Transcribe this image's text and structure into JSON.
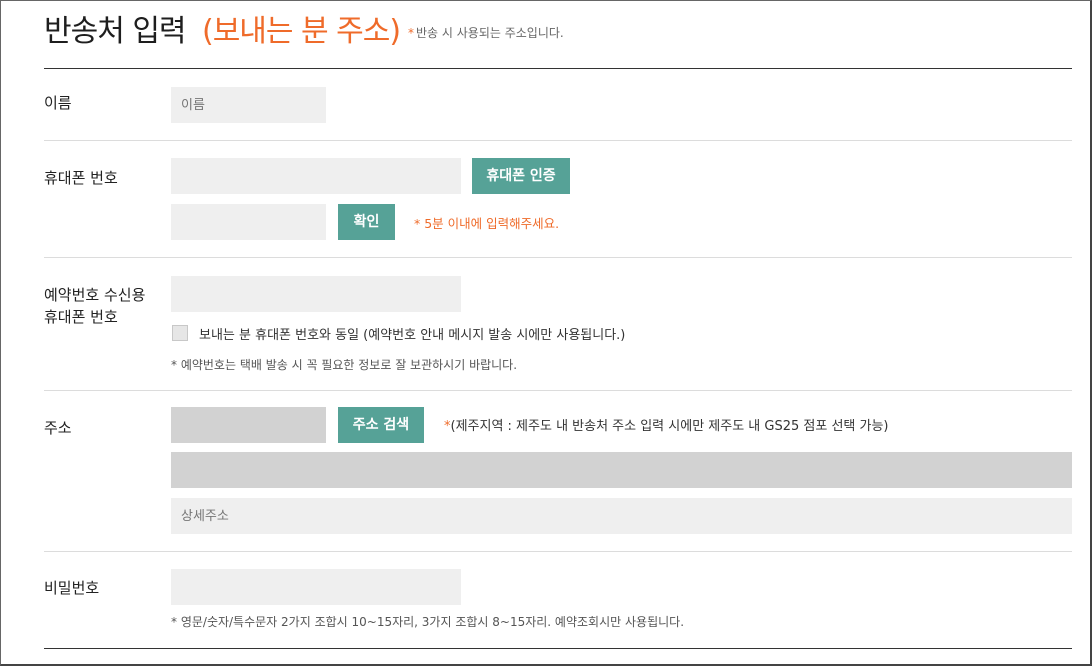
{
  "header": {
    "title": "반송처 입력",
    "subtitle": "(보내는 분 주소)",
    "note_star": "*",
    "note": "반송 시 사용되는 주소입니다."
  },
  "name": {
    "label": "이름",
    "placeholder": "이름"
  },
  "phone": {
    "label": "휴대폰 번호",
    "verify_button": "휴대폰 인증",
    "confirm_button": "확인",
    "timer_note": "* 5분 이내에 입력해주세요."
  },
  "reservation_phone": {
    "label_line1": "예약번호 수신용",
    "label_line2": "휴대폰 번호",
    "same_checkbox_label": "보내는 분 휴대폰 번호와 동일 (예약번호 안내 메시지 발송 시에만 사용됩니다.)",
    "note": "* 예약번호는 택배 발송 시 꼭 필요한 정보로 잘 보관하시기 바랍니다."
  },
  "address": {
    "label": "주소",
    "search_button": "주소 검색",
    "jeju_note_star": "*",
    "jeju_note": "(제주지역 : 제주도 내 반송처 주소 입력 시에만 제주도 내 GS25 점포 선택 가능)",
    "detail_placeholder": "상세주소"
  },
  "password": {
    "label": "비밀번호",
    "note": "* 영문/숫자/특수문자 2가지 조합시 10~15자리, 3가지 조합시 8~15자리. 예약조회시만 사용됩니다."
  },
  "colors": {
    "accent": "#ef6b2a",
    "button": "#56a297",
    "field": "#efefef",
    "field_disabled": "#d2d2d2"
  }
}
